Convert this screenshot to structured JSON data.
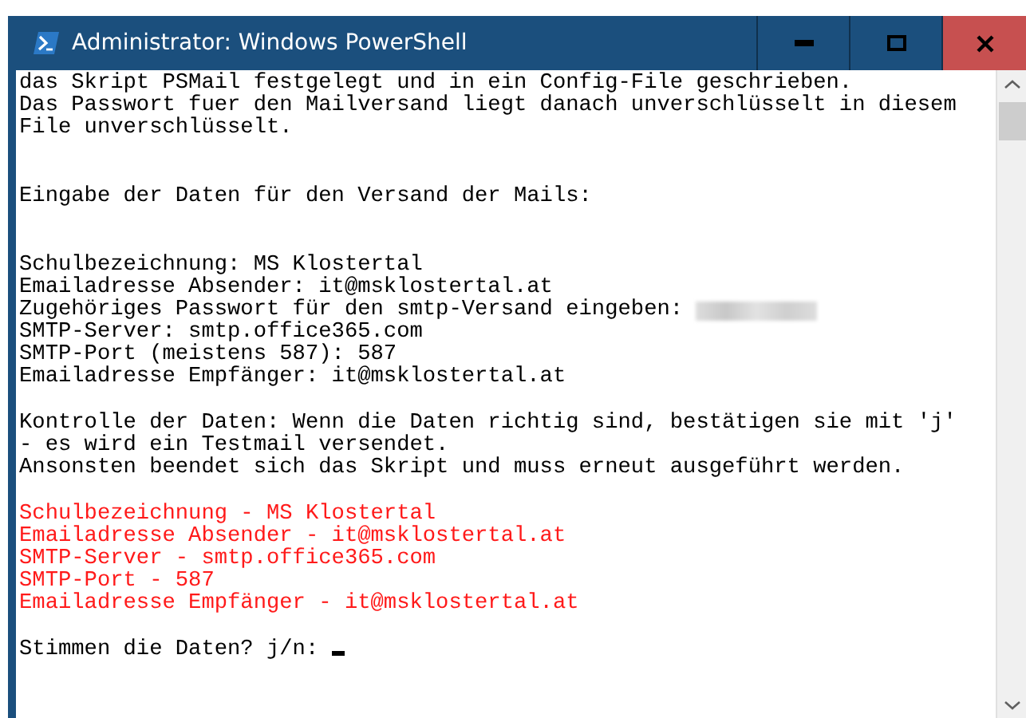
{
  "window": {
    "title": "Administrator: Windows PowerShell"
  },
  "lines": [
    {
      "kind": "output",
      "text": "das Skript PSMail festgelegt und in ein Config-File geschrieben."
    },
    {
      "kind": "output",
      "text": "Das Passwort fuer den Mailversand liegt danach unverschlüsselt in diesem"
    },
    {
      "kind": "output",
      "text": "File unverschlüsselt."
    },
    {
      "kind": "blank"
    },
    {
      "kind": "blank"
    },
    {
      "kind": "output",
      "text": "Eingabe der Daten für den Versand der Mails:"
    },
    {
      "kind": "blank"
    },
    {
      "kind": "blank"
    },
    {
      "kind": "output",
      "text": "Schulbezeichnung: MS Klostertal"
    },
    {
      "kind": "output",
      "text": "Emailadresse Absender: it@msklostertal.at"
    },
    {
      "kind": "secret",
      "text": "Zugehöriges Passwort für den smtp-Versand eingeben:"
    },
    {
      "kind": "output",
      "text": "SMTP-Server: smtp.office365.com"
    },
    {
      "kind": "output",
      "text": "SMTP-Port (meistens 587): 587"
    },
    {
      "kind": "output",
      "text": "Emailadresse Empfänger: it@msklostertal.at"
    },
    {
      "kind": "blank"
    },
    {
      "kind": "output",
      "text": "Kontrolle der Daten: Wenn die Daten richtig sind, bestätigen sie mit 'j'"
    },
    {
      "kind": "output",
      "text": "- es wird ein Testmail versendet."
    },
    {
      "kind": "output",
      "text": "Ansonsten beendet sich das Skript und muss erneut ausgeführt werden."
    },
    {
      "kind": "blank"
    },
    {
      "kind": "warning",
      "text": "Schulbezeichnung - MS Klostertal"
    },
    {
      "kind": "warning",
      "text": "Emailadresse Absender - it@msklostertal.at"
    },
    {
      "kind": "warning",
      "text": "SMTP-Server - smtp.office365.com"
    },
    {
      "kind": "warning",
      "text": "SMTP-Port - 587"
    },
    {
      "kind": "warning",
      "text": "Emailadresse Empfänger - it@msklostertal.at"
    },
    {
      "kind": "blank"
    },
    {
      "kind": "prompt",
      "text": "Stimmen die Daten? j/n:"
    }
  ]
}
